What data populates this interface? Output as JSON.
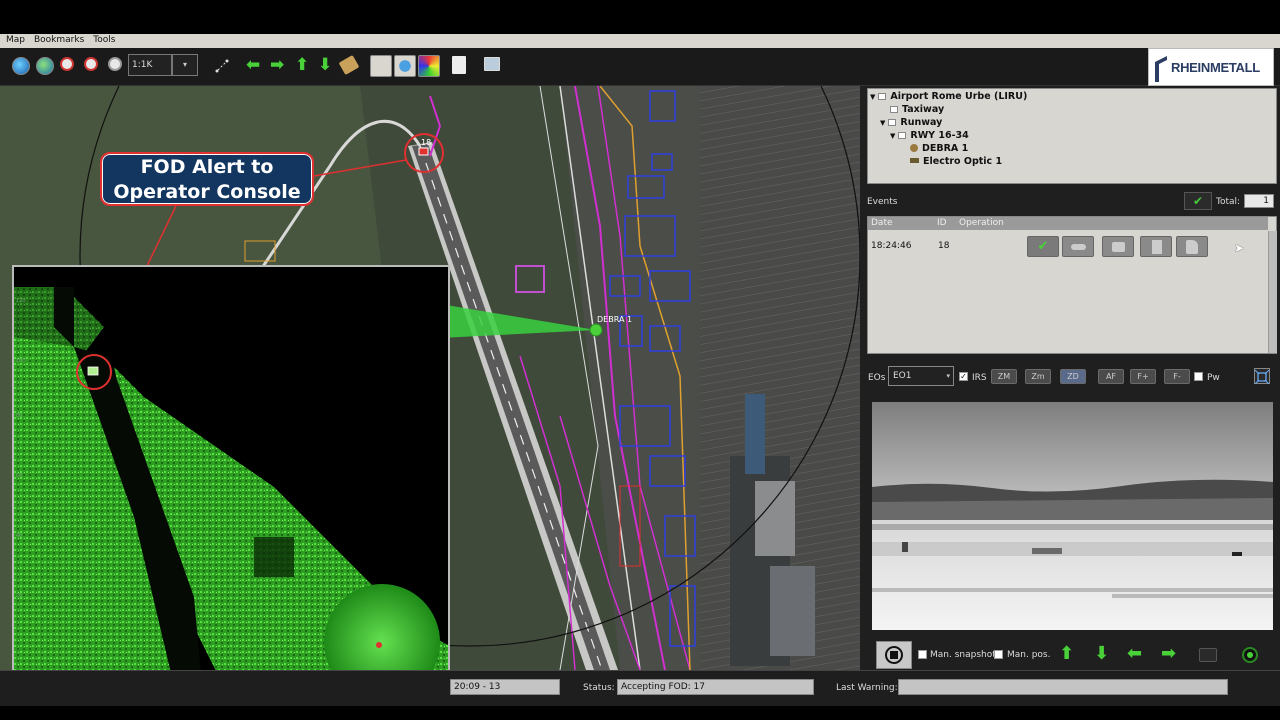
{
  "menu": {
    "items": [
      "Map",
      "Bookmarks",
      "Tools"
    ]
  },
  "toolbar": {
    "zoom_value": "1:1K",
    "icons": [
      "globe-icon",
      "globe-alt-icon",
      "zoom-in-icon",
      "zoom-out-icon",
      "zoom-fit-icon",
      "measure-icon",
      "arrow-left-icon",
      "arrow-right-icon",
      "arrow-up-icon",
      "arrow-down-icon",
      "tag-icon",
      "select-icon",
      "layer-icon",
      "color-icon",
      "document-icon",
      "window-icon"
    ]
  },
  "logo": {
    "text": "RHEINMETALL"
  },
  "map": {
    "callout_line1": "FOD Alert to",
    "callout_line2": "Operator Console",
    "marker_id": "18",
    "sensor_label": "DEBRA 1"
  },
  "tree": {
    "root": "Airport Rome Urbe (LIRU)",
    "taxiway": "Taxiway",
    "runway": "Runway",
    "rwy": "RWY 16-34",
    "debra": "DEBRA 1",
    "electro_optic": "Electro Optic 1"
  },
  "events": {
    "label": "Events",
    "total_label": "Total:",
    "total_value": "1",
    "columns": [
      "Date",
      "ID",
      "Operation"
    ],
    "rows": [
      {
        "date": "18:24:46",
        "id": "18"
      }
    ]
  },
  "eo": {
    "label": "EOs",
    "selected": "EO1",
    "irs_label": "IRS",
    "buttons": [
      "ZM",
      "Zm",
      "ZD",
      "AF",
      "F+",
      "F-"
    ],
    "pw_label": "Pw"
  },
  "camera_controls": {
    "man_snapshot": "Man. snapshot",
    "man_pos": "Man. pos."
  },
  "status": {
    "time_field": "20:09 - 13",
    "status_label": "Status:",
    "status_value": "Accepting FOD: 17",
    "warning_label": "Last Warning:",
    "warning_value": ""
  },
  "colors": {
    "accent_green": "#4ad13a",
    "alert_red": "#e03030",
    "callout_blue": "#123660",
    "radar_green": "#38c42a"
  }
}
